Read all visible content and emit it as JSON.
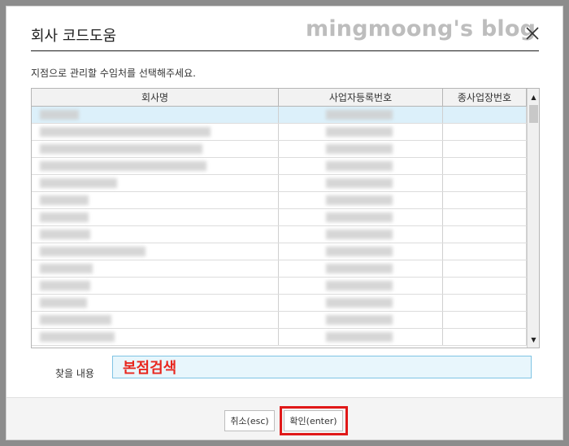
{
  "dialog": {
    "title": "회사 코드도움",
    "watermark": "mingmoong's blog",
    "instruction": "지점으로 관리할 수임처를 선택해주세요."
  },
  "grid": {
    "columns": [
      "회사명",
      "사업자등록번호",
      "종사업장번호"
    ],
    "selected_row_index": 0,
    "row_count": 14
  },
  "search": {
    "label": "찾을 내용",
    "value": "본점검색"
  },
  "footer": {
    "cancel_label": "취소(esc)",
    "confirm_label": "확인(enter)"
  },
  "colors": {
    "accent_red": "#e01818",
    "selected_row": "#dcf0fa",
    "input_bg": "#e8f6fc"
  }
}
